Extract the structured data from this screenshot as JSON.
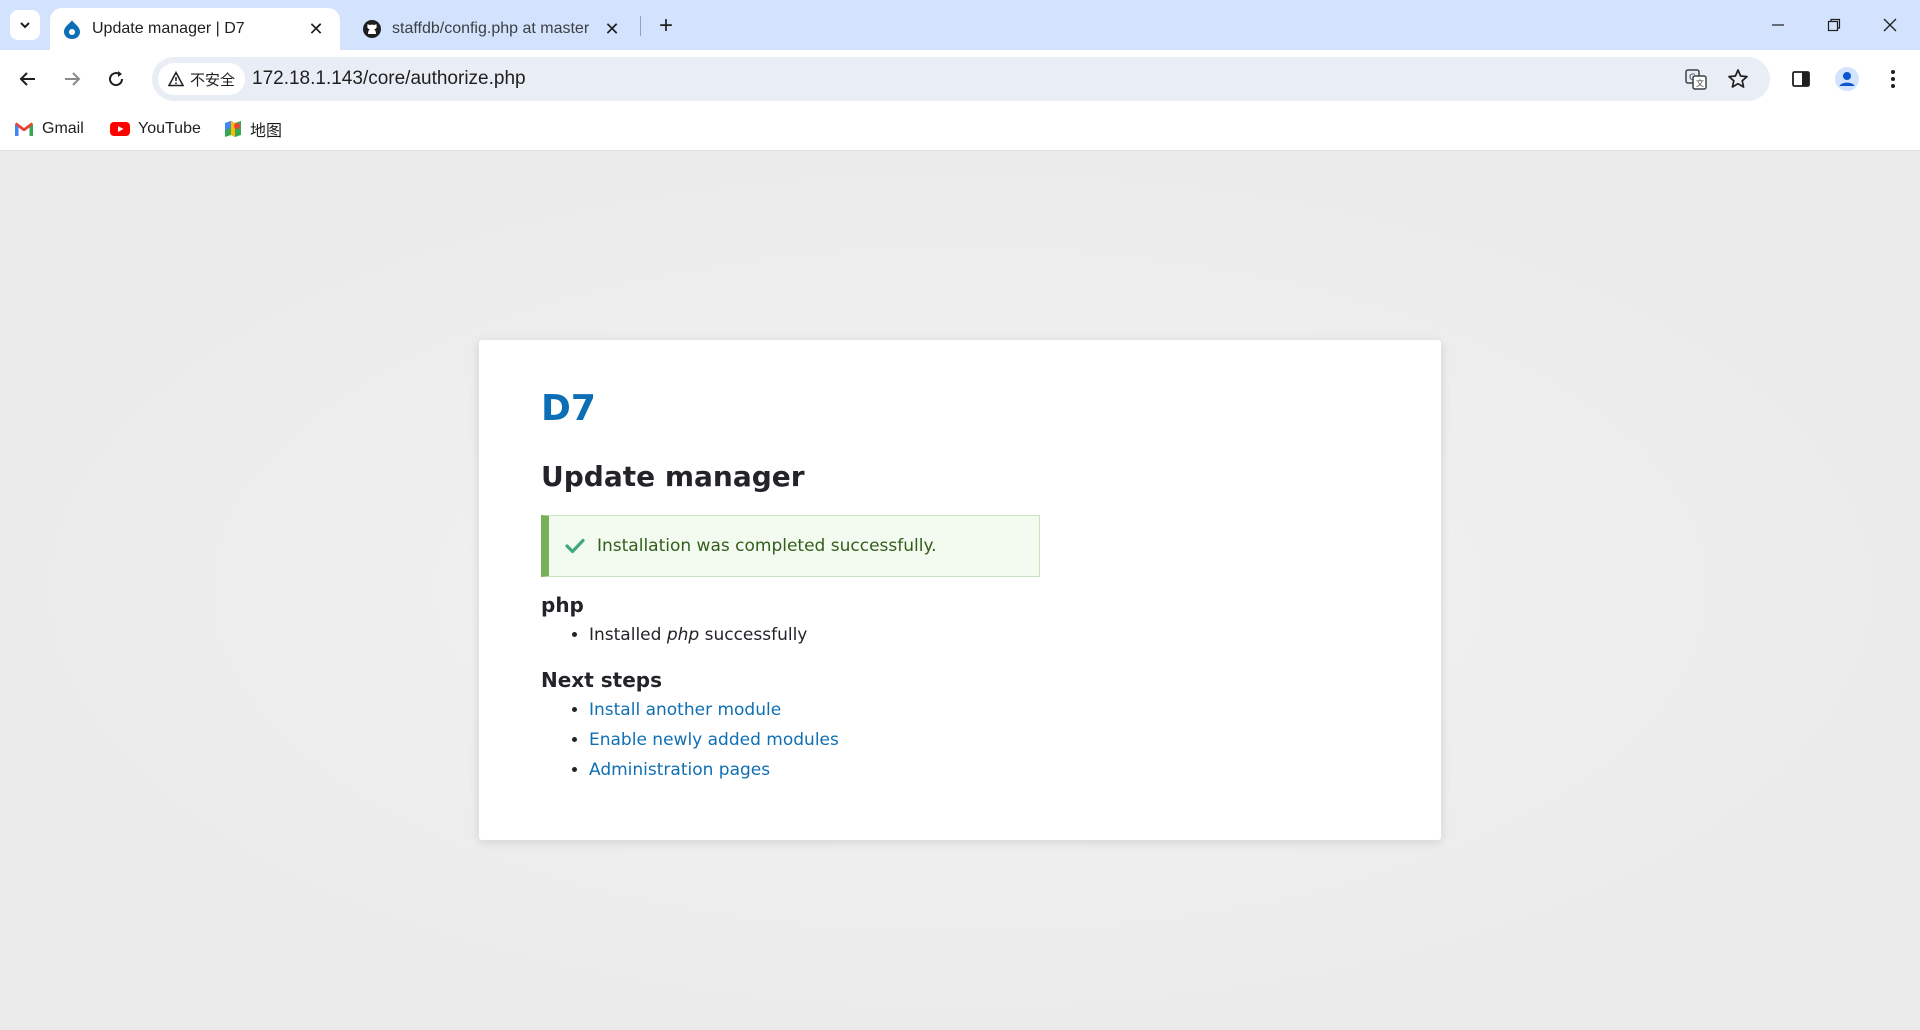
{
  "browser": {
    "tabs": [
      {
        "title": "Update manager | D7",
        "active": true,
        "icon": "drupal-icon"
      },
      {
        "title": "staffdb/config.php at master",
        "active": false,
        "icon": "github-icon"
      }
    ],
    "security_label": "不安全",
    "url": "172.18.1.143/core/authorize.php",
    "bookmarks": [
      {
        "label": "Gmail",
        "icon": "gmail-icon"
      },
      {
        "label": "YouTube",
        "icon": "youtube-icon"
      },
      {
        "label": "地图",
        "icon": "maps-icon"
      }
    ]
  },
  "page": {
    "site_name": "D7",
    "title": "Update manager",
    "status_message": "Installation was completed successfully.",
    "project": {
      "heading": "php",
      "items": [
        {
          "prefix": "Installed ",
          "emphasis": "php",
          "suffix": " successfully"
        }
      ]
    },
    "next_steps": {
      "heading": "Next steps",
      "links": [
        "Install another module",
        "Enable newly added modules",
        "Administration pages"
      ]
    }
  },
  "colors": {
    "accent": "#0c6fb5",
    "link": "#0f6fb3",
    "success_border": "#77b259",
    "success_bg": "#f3faef",
    "tabstrip": "#d3e3fd"
  }
}
